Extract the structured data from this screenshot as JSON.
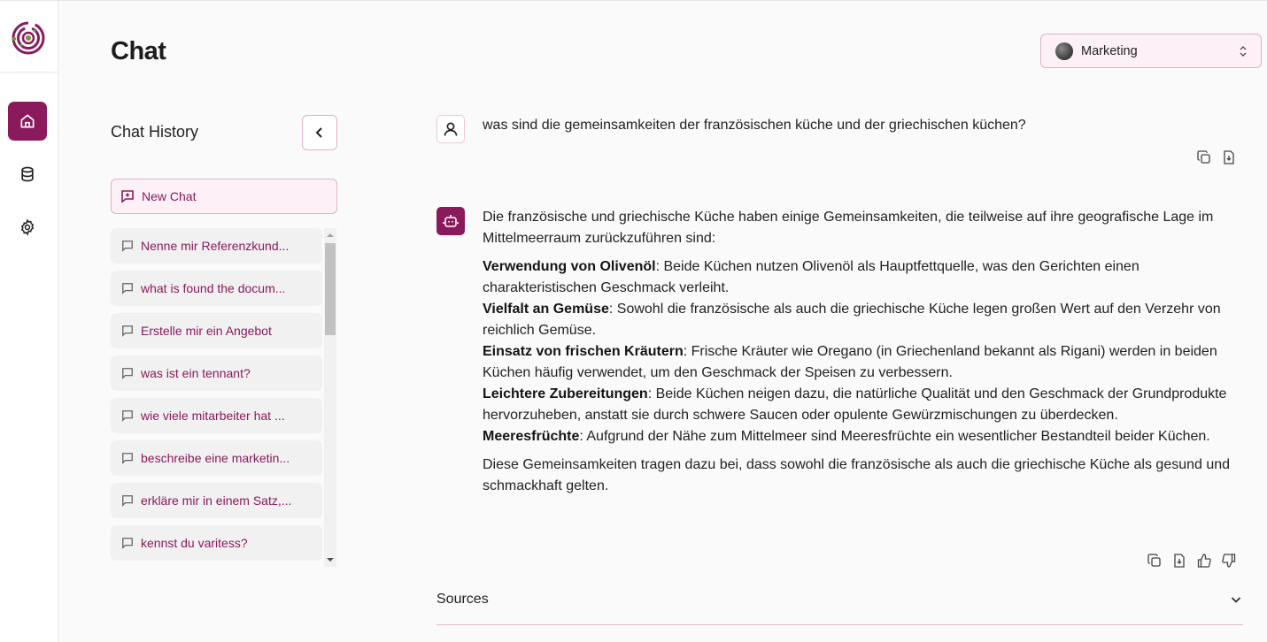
{
  "app": {
    "page_title": "Chat",
    "accent_color": "#8a1a5c",
    "logo_icon": "spiral-logo-icon"
  },
  "rail": {
    "items": [
      {
        "name": "home",
        "icon": "home-icon",
        "active": true
      },
      {
        "name": "database",
        "icon": "database-icon",
        "active": false
      },
      {
        "name": "settings",
        "icon": "gear-icon",
        "active": false
      }
    ]
  },
  "workspace_select": {
    "value": "Marketing",
    "icon": "chevron-up-down-icon"
  },
  "history": {
    "title": "Chat History",
    "collapse_icon": "chevron-left-icon",
    "new_chat_label": "New Chat",
    "items": [
      {
        "label": "Nenne mir Referenzkund..."
      },
      {
        "label": "what is found the docum..."
      },
      {
        "label": "Erstelle mir ein Angebot"
      },
      {
        "label": "was ist ein tennant?"
      },
      {
        "label": "wie viele mitarbeiter hat ..."
      },
      {
        "label": "beschreibe eine marketin..."
      },
      {
        "label": "erkläre mir in einem Satz,..."
      },
      {
        "label": "kennst du varitess?"
      }
    ]
  },
  "conversation": {
    "user_message": "was sind die gemeinsamkeiten der französischen küche und der griechischen küchen?",
    "bot_intro": "Die französische und griechische Küche haben einige Gemeinsamkeiten, die teilweise auf ihre geografische Lage im Mittelmeerraum zurückzuführen sind:",
    "bot_points": [
      {
        "title": "Verwendung von Olivenöl",
        "text": ": Beide Küchen nutzen Olivenöl als Hauptfettquelle, was den Gerichten einen charakteristischen Geschmack verleiht."
      },
      {
        "title": "Vielfalt an Gemüse",
        "text": ": Sowohl die französische als auch die griechische Küche legen großen Wert auf den Verzehr von reichlich Gemüse."
      },
      {
        "title": "Einsatz von frischen Kräutern",
        "text": ": Frische Kräuter wie Oregano (in Griechenland bekannt als Rigani) werden in beiden Küchen häufig verwendet, um den Geschmack der Speisen zu verbessern."
      },
      {
        "title": "Leichtere Zubereitungen",
        "text": ": Beide Küchen neigen dazu, die natürliche Qualität und den Geschmack der Grundprodukte hervorzuheben, anstatt sie durch schwere Saucen oder opulente Gewürzmischungen zu überdecken."
      },
      {
        "title": "Meeresfrüchte",
        "text": ": Aufgrund der Nähe zum Mittelmeer sind Meeresfrüchte ein wesentlicher Bestandteil beider Küchen."
      }
    ],
    "bot_conclusion": "Diese Gemeinsamkeiten tragen dazu bei, dass sowohl die französische als auch die griechische Küche als gesund und schmackhaft gelten.",
    "user_actions": [
      "copy-icon",
      "export-file-icon"
    ],
    "bot_actions": [
      "copy-icon",
      "export-file-icon",
      "thumbs-up-icon",
      "thumbs-down-icon"
    ]
  },
  "sources": {
    "label": "Sources",
    "icon": "chevron-down-icon"
  }
}
